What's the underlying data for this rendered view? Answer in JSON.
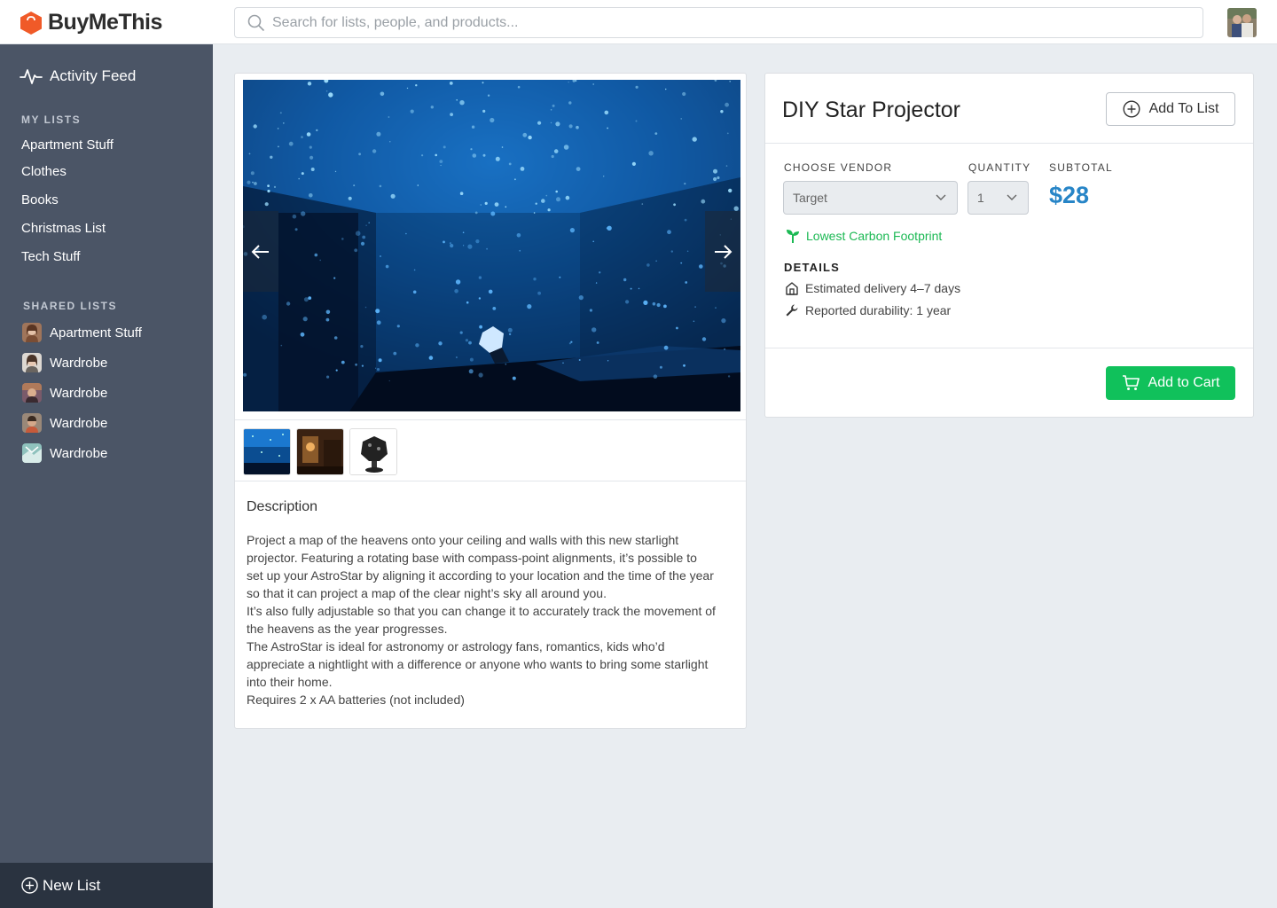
{
  "app": {
    "name": "BuyMeThis",
    "brand_color": "#f05a28"
  },
  "search": {
    "placeholder": "Search for lists, people, and products..."
  },
  "sidebar": {
    "activity_feed": "Activity Feed",
    "my_lists_heading": "MY LISTS",
    "my_lists": [
      {
        "label": "Apartment Stuff"
      },
      {
        "label": "Clothes"
      },
      {
        "label": "Books"
      },
      {
        "label": "Christmas List"
      },
      {
        "label": "Tech Stuff"
      }
    ],
    "shared_lists_heading": "SHARED LISTS",
    "shared_lists": [
      {
        "label": "Apartment Stuff"
      },
      {
        "label": "Wardrobe"
      },
      {
        "label": "Wardrobe"
      },
      {
        "label": "Wardrobe"
      },
      {
        "label": "Wardrobe"
      }
    ],
    "new_list": "New List"
  },
  "product": {
    "title": "DIY Star Projector",
    "add_to_list": "Add To List",
    "vendor_label": "CHOOSE VENDOR",
    "vendor_value": "Target",
    "quantity_label": "QUANTITY",
    "quantity_value": "1",
    "subtotal_label": "SUBTOTAL",
    "subtotal_value": "$28",
    "carbon_badge": "Lowest Carbon Footprint",
    "details_heading": "DETAILS",
    "details": [
      {
        "icon": "house-icon",
        "text": "Estimated delivery 4–7 days"
      },
      {
        "icon": "wrench-icon",
        "text": "Reported durability: 1 year"
      }
    ],
    "add_to_cart": "Add to Cart",
    "description_heading": "Description",
    "description_lines": [
      "Project a map of the heavens onto your ceiling and walls with this new starlight projector. Featuring a rotating base with compass-point alignments, it’s possible to set up your AstroStar by aligning it according to your location and the time of the year so that it can project a map of the clear night’s sky all around you.",
      "It’s also fully adjustable so that you can change it to accurately track the movement of the heavens as the year progresses.",
      "The AstroStar is ideal for astronomy or astrology fans, romantics, kids who’d appreciate a nightlight with a difference or anyone who wants to bring some starlight into their home.",
      "Requires 2 x AA batteries (not included)"
    ]
  },
  "colors": {
    "sidebar_bg": "#4b5566",
    "new_list_bg": "#2a3340",
    "accent_blue": "#2785c7",
    "cart_green": "#10c15b",
    "carbon_green": "#1cb954"
  }
}
